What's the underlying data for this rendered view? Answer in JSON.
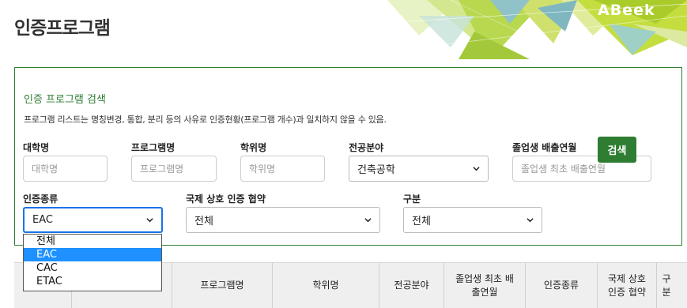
{
  "page": {
    "title": "인증프로그램",
    "logo_text": "ABeek"
  },
  "panel": {
    "title": "인증 프로그램 검색",
    "notice": "프로그램 리스트는 명칭변경, 통합, 분리 등의 사유로 인증현황(프로그램 개수)과 일치하지 않을 수 있음."
  },
  "filters": {
    "university": {
      "label": "대학명",
      "placeholder": "대학명"
    },
    "program": {
      "label": "프로그램명",
      "placeholder": "프로그램명"
    },
    "degree": {
      "label": "학위명",
      "placeholder": "학위명"
    },
    "major_field": {
      "label": "전공분야",
      "value": "건축공학"
    },
    "graduation": {
      "label": "졸업생 배출연월",
      "placeholder": "졸업생 최초 배출연월"
    },
    "cert_type": {
      "label": "인증종류",
      "value": "EAC",
      "options": [
        "전체",
        "EAC",
        "CAC",
        "ETAC"
      ]
    },
    "accord": {
      "label": "국제 상호 인증 협약",
      "value": "전체"
    },
    "category": {
      "label": "구분",
      "value": "전체"
    }
  },
  "search_button": "검색",
  "table": {
    "columns": [
      "",
      "",
      "프로그램명",
      "학위명",
      "전공분야",
      "졸업생 최초 배출연월",
      "인증종류",
      "국제 상호 인증 협약",
      "구분"
    ]
  },
  "colors": {
    "brand_green": "#2e7d32",
    "focus_blue": "#1a73e8",
    "option_highlight": "#1e90ff"
  }
}
